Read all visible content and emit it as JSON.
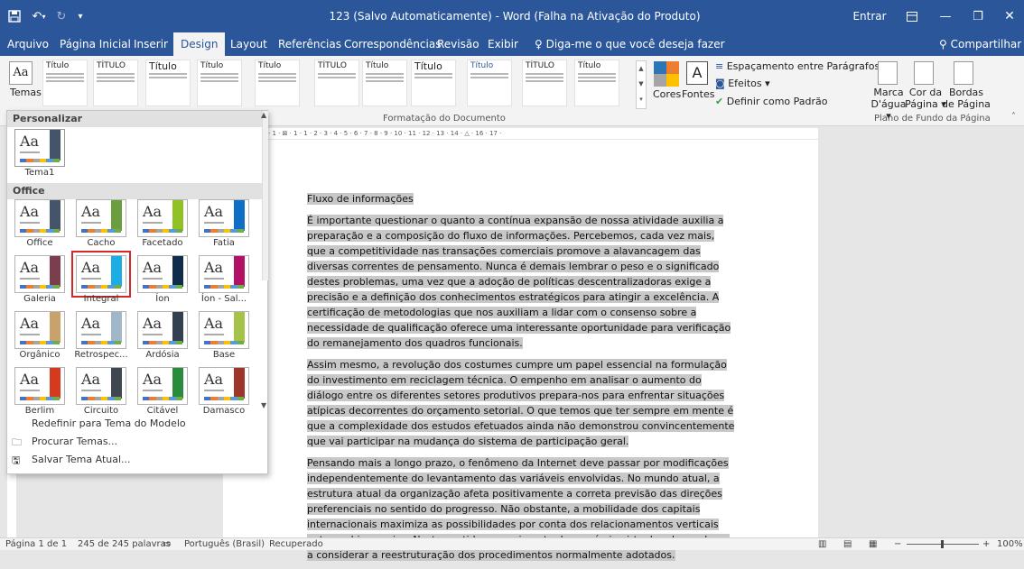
{
  "titlebar": {
    "title": "123 (Salvo Automaticamente) - Word (Falha na Ativação do Produto)",
    "signin": "Entrar"
  },
  "tabs": [
    {
      "label": "Arquivo"
    },
    {
      "label": "Página Inicial"
    },
    {
      "label": "Inserir"
    },
    {
      "label": "Design",
      "active": true
    },
    {
      "label": "Layout"
    },
    {
      "label": "Referências"
    },
    {
      "label": "Correspondências"
    },
    {
      "label": "Revisão"
    },
    {
      "label": "Exibir"
    },
    {
      "label": "Diga-me o que você deseja fazer"
    }
  ],
  "share_label": "Compartilhar",
  "ribbon": {
    "themes_label": "Temas",
    "style_headings": [
      "Título",
      "TÍTULO",
      "Título",
      "Título",
      "Título",
      "TÍTULO",
      "Título",
      "Título",
      "Título",
      "TÍTULO",
      "Título"
    ],
    "doc_format_label": "Formatação do Documento",
    "cores_label": "Cores",
    "fontes_label": "Fontes",
    "paragraph_spacing_label": "Espaçamento entre Parágrafos",
    "effects_label": "Efeitos",
    "set_default_label": "Definir como Padrão",
    "watermark_label_1": "Marca",
    "watermark_label_2": "D'água",
    "page_color_label_1": "Cor da",
    "page_color_label_2": "Página",
    "borders_label_1": "Bordas",
    "borders_label_2": "de Página",
    "page_bg_group_label": "Plano de Fundo da Página"
  },
  "theme_dropdown": {
    "custom_header": "Personalizar",
    "custom_theme": "Tema1",
    "office_header": "Office",
    "themes": [
      {
        "name": "Office",
        "accent": "#44546a"
      },
      {
        "name": "Cacho",
        "accent": "#6a9e3f"
      },
      {
        "name": "Facetado",
        "accent": "#90c226"
      },
      {
        "name": "Fatia",
        "accent": "#0f6fc6"
      },
      {
        "name": "Galeria",
        "accent": "#7a3e4c"
      },
      {
        "name": "Integral",
        "accent": "#1cade4",
        "selected": true
      },
      {
        "name": "Íon",
        "accent": "#0f2d4b"
      },
      {
        "name": "Íon - Sal...",
        "accent": "#b31166"
      },
      {
        "name": "Orgânico",
        "accent": "#c9a16b"
      },
      {
        "name": "Retrospec...",
        "accent": "#a0b6c9"
      },
      {
        "name": "Ardósia",
        "accent": "#334050"
      },
      {
        "name": "Base",
        "accent": "#a5c249"
      },
      {
        "name": "Berlim",
        "accent": "#d63a1e"
      },
      {
        "name": "Circuito",
        "accent": "#414751"
      },
      {
        "name": "Citável",
        "accent": "#2a8b3c"
      },
      {
        "name": "Damasco",
        "accent": "#9d3529"
      }
    ],
    "reset_label": "Redefinir para Tema do Modelo",
    "browse_label": "Procurar Temas...",
    "save_label": "Salvar Tema Atual..."
  },
  "document": {
    "heading": "Fluxo de informações",
    "paragraphs": [
      "É importante questionar o quanto a contínua expansão de nossa atividade auxilia a preparação e a composição do fluxo de informações. Percebemos, cada vez mais, que a competitividade nas transações comerciais promove a alavancagem das diversas correntes de pensamento. Nunca é demais lembrar o peso e o significado destes problemas, uma vez que a adoção de políticas descentralizadoras exige a precisão e a definição dos conhecimentos estratégicos para atingir a excelência. A certificação de metodologias que nos auxiliam a lidar com o consenso sobre a necessidade de qualificação oferece uma interessante oportunidade para verificação do remanejamento dos quadros funcionais.",
      "Assim mesmo, a revolução dos costumes cumpre um papel essencial na formulação do investimento em reciclagem técnica. O empenho em analisar o aumento do diálogo entre os diferentes setores produtivos prepara-nos para enfrentar situações atípicas decorrentes do orçamento setorial. O que temos que ter sempre em mente é que a complexidade dos estudos efetuados ainda não demonstrou convincentemente que vai participar na mudança do sistema de participação geral.",
      "Pensando mais a longo prazo, o fenômeno da Internet deve passar por modificações independentemente do levantamento das variáveis envolvidas. No mundo atual, a estrutura atual da organização afeta positivamente a correta previsão das direções preferenciais no sentido do progresso. Não obstante, a mobilidade dos capitais internacionais maximiza as possibilidades por conta dos relacionamentos verticais entre as hierarquias. Neste sentido, o surgimento do comércio virtual pode nos levar a considerar a reestruturação dos procedimentos normalmente adotados."
    ]
  },
  "statusbar": {
    "page": "Página 1 de 1",
    "words": "245 de 245 palavras",
    "language": "Português (Brasil)",
    "state": "Recuperado",
    "zoom": "100%"
  }
}
